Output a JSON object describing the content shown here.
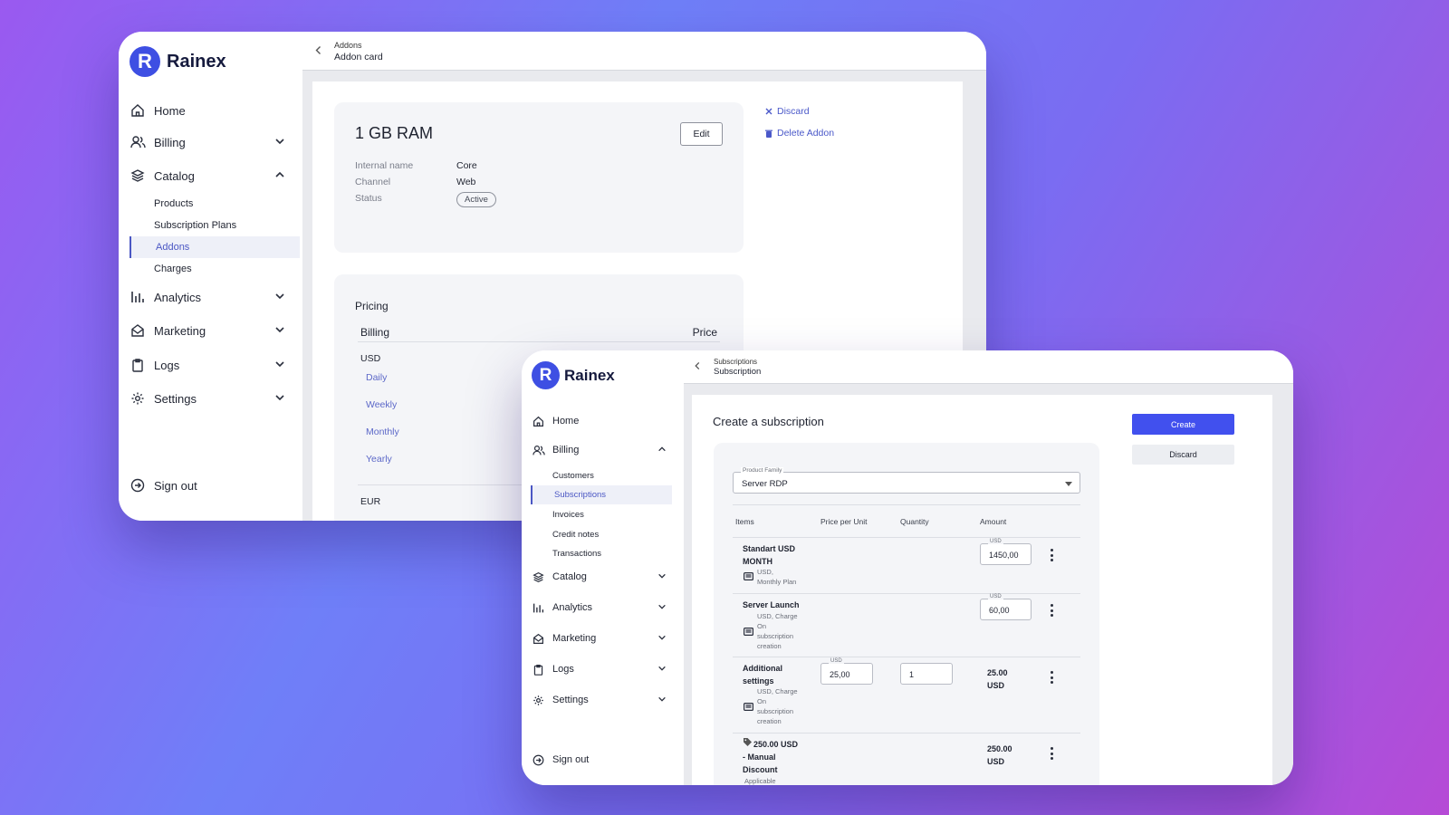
{
  "brand": {
    "letter": "R",
    "name": "Rainex",
    "color": "#3e4fe3"
  },
  "w1": {
    "nav": {
      "home": "Home",
      "billing": "Billing",
      "catalog": "Catalog",
      "analytics": "Analytics",
      "marketing": "Marketing",
      "logs": "Logs",
      "settings": "Settings",
      "signout": "Sign out"
    },
    "catalog_items": [
      "Products",
      "Subscription Plans",
      "Addons",
      "Charges"
    ],
    "breadcrumb": {
      "parent": "Addons",
      "current": "Addon card"
    },
    "addon": {
      "title": "1 GB RAM",
      "edit": "Edit",
      "fields": [
        {
          "k": "Internal name",
          "v": "Core"
        },
        {
          "k": "Channel",
          "v": "Web"
        },
        {
          "k": "Status",
          "v": "Active"
        }
      ]
    },
    "actions": {
      "discard": "Discard",
      "delete": "Delete Addon"
    },
    "pricing": {
      "title": "Pricing",
      "col_billing": "Billing",
      "col_price": "Price",
      "currency1": "USD",
      "periods": [
        "Daily",
        "Weekly",
        "Monthly",
        "Yearly"
      ],
      "currency2": "EUR"
    }
  },
  "w2": {
    "nav": {
      "home": "Home",
      "billing": "Billing",
      "catalog": "Catalog",
      "analytics": "Analytics",
      "marketing": "Marketing",
      "logs": "Logs",
      "settings": "Settings",
      "signout": "Sign out"
    },
    "billing_items": [
      "Customers",
      "Subscriptions",
      "Invoices",
      "Credit notes",
      "Transactions"
    ],
    "breadcrumb": {
      "parent": "Subscriptions",
      "current": "Subscription"
    },
    "page_title": "Create a subscription",
    "buttons": {
      "create": "Create",
      "discard": "Discard"
    },
    "product_family": {
      "label": "Product Family",
      "value": "Server RDP"
    },
    "table": {
      "cols": [
        "Items",
        "Price per Unit",
        "Quantity",
        "Amount"
      ]
    },
    "items": [
      {
        "name1": "Standart USD",
        "name2": "MONTH",
        "meta": [
          "USD,",
          "Monthly Plan"
        ],
        "amount_label": "USD",
        "amount_value": "1450,00"
      },
      {
        "name1": "Server Launch",
        "meta": [
          "USD, Charge",
          "On",
          "subscription",
          "creation"
        ],
        "amount_label": "USD",
        "amount_value": "60,00"
      },
      {
        "name1": "Additional",
        "name2": "settings",
        "meta": [
          "USD, Charge",
          "On",
          "subscription",
          "creation"
        ],
        "price_label": "USD",
        "price_value": "25,00",
        "qty": "1",
        "amount1": "25.00",
        "amount2": "USD"
      },
      {
        "name1": "250.00 USD",
        "name2": "- Manual",
        "name3": "Discount",
        "meta": [
          "Applicable"
        ],
        "amount1": "250.00",
        "amount2": "USD"
      }
    ]
  }
}
